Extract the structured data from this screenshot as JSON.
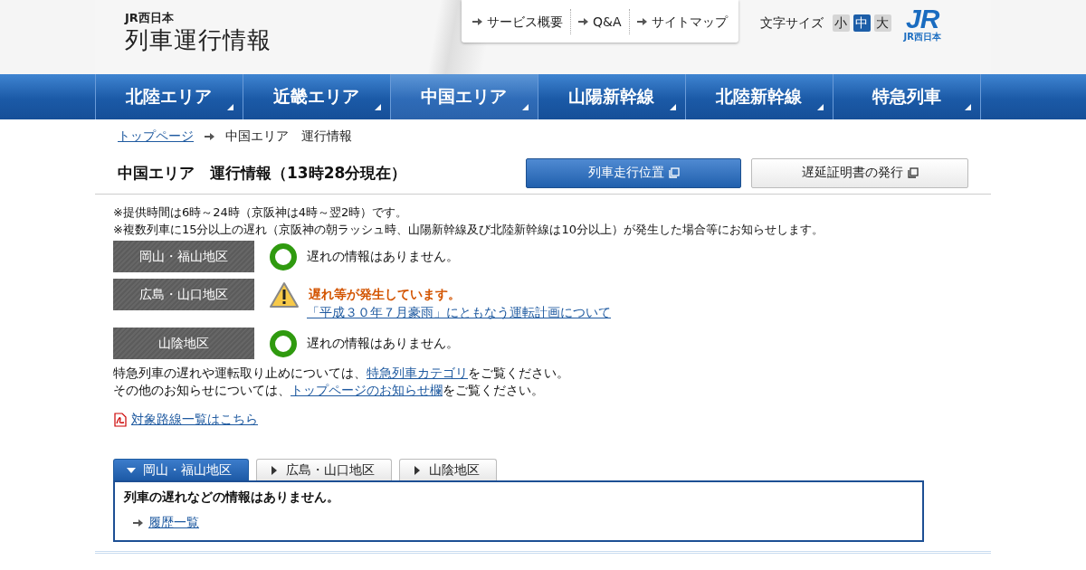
{
  "logo": {
    "small": "JR西日本",
    "title": "列車運行情報"
  },
  "top_links": [
    "サービス概要",
    "Q&A",
    "サイトマップ"
  ],
  "font_size": {
    "label": "文字サイズ",
    "options": [
      {
        "label": "小",
        "selected": false
      },
      {
        "label": "中",
        "selected": true
      },
      {
        "label": "大",
        "selected": false
      }
    ]
  },
  "brand_logo": {
    "mark": "JR",
    "caption": "JR西日本"
  },
  "nav": [
    {
      "label": "北陸エリア",
      "selected": false
    },
    {
      "label": "近畿エリア",
      "selected": false
    },
    {
      "label": "中国エリア",
      "selected": true
    },
    {
      "label": "山陽新幹線",
      "selected": false
    },
    {
      "label": "北陸新幹線",
      "selected": false
    },
    {
      "label": "特急列車",
      "selected": false
    }
  ],
  "breadcrumb": [
    {
      "label": "トップページ",
      "kind": "link"
    },
    {
      "label": "中国エリア　運行情報",
      "kind": "current"
    }
  ],
  "heading": "中国エリア　運行情報（13時28分現在）",
  "buttons": [
    {
      "label": "列車走行位置",
      "kind": "primary"
    },
    {
      "label": "遅延証明書の発行",
      "kind": "secondary"
    }
  ],
  "notes": [
    "※提供時間は6時～24時（京阪神は4時～翌2時）です。",
    "※複数列車に15分以上の遅れ（京阪神の朝ラッシュ時、山陽新幹線及び北陸新幹線は10分以上）が発生した場合等にお知らせします。"
  ],
  "areas": [
    {
      "name": "岡山・福山地区",
      "kind": "normal",
      "message": "遅れの情報はありません。"
    },
    {
      "name": "広島・山口地区",
      "kind": "delay",
      "message": "遅れ等が発生しています。",
      "link": "「平成３０年７月豪雨」にともなう運転計画について"
    },
    {
      "name": "山陰地区",
      "kind": "normal",
      "message": "遅れの情報はありません。"
    }
  ],
  "info_lines": [
    {
      "before": "特急列車の遅れや運転取り止めについては、",
      "link": "特急列車カテゴリ",
      "after": "をご覧ください。"
    },
    {
      "before": "その他のお知らせについては、",
      "link": "トップページのお知らせ欄",
      "after": "をご覧ください。"
    }
  ],
  "pdf_link": "対象路線一覧はこちら",
  "tabs": [
    {
      "label": "岡山・福山地区",
      "selected": true
    },
    {
      "label": "広島・山口地区",
      "selected": false
    },
    {
      "label": "山陰地区",
      "selected": false
    }
  ],
  "panel": {
    "message": "列車の遅れなどの情報はありません。",
    "history_link": "履歴一覧"
  }
}
